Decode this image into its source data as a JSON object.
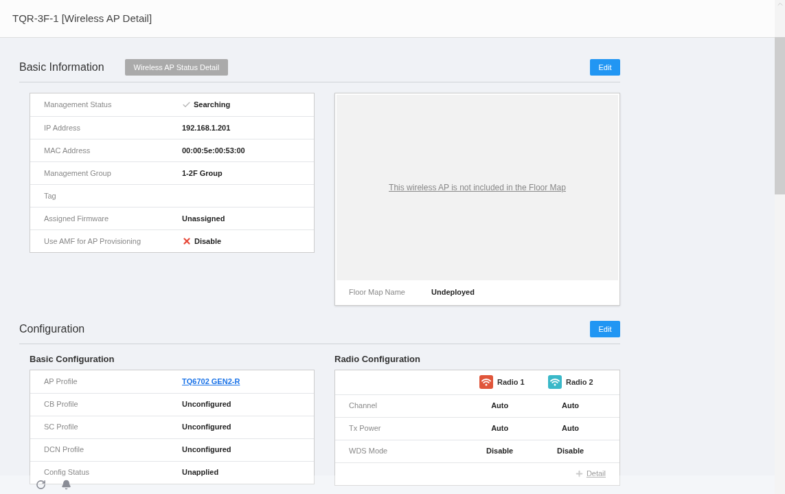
{
  "window": {
    "title": "TQR-3F-1 [Wireless AP Detail]"
  },
  "basic_information": {
    "title": "Basic Information",
    "status_button": "Wireless AP Status Detail",
    "edit_button": "Edit",
    "rows": [
      {
        "label": "Management Status",
        "value": "Searching",
        "kind": "check"
      },
      {
        "label": "IP Address",
        "value": "192.168.1.201",
        "kind": "text"
      },
      {
        "label": "MAC Address",
        "value": "00:00:5e:00:53:00",
        "kind": "text"
      },
      {
        "label": "Management Group",
        "value": "1-2F Group",
        "kind": "text"
      },
      {
        "label": "Tag",
        "value": "",
        "kind": "text"
      },
      {
        "label": "Assigned Firmware",
        "value": "Unassigned",
        "kind": "text"
      },
      {
        "label": "Use AMF for AP Provisioning",
        "value": "Disable",
        "kind": "cross"
      }
    ],
    "floor_map": {
      "message": "This wireless AP is not included in the Floor Map",
      "name_label": "Floor Map Name",
      "name_value": "Undeployed"
    }
  },
  "configuration": {
    "title": "Configuration",
    "edit_button": "Edit",
    "basic": {
      "title": "Basic Configuration",
      "rows": [
        {
          "label": "AP Profile",
          "value": "TQ6702 GEN2-R",
          "kind": "link"
        },
        {
          "label": "CB Profile",
          "value": "Unconfigured",
          "kind": "text"
        },
        {
          "label": "SC Profile",
          "value": "Unconfigured",
          "kind": "text"
        },
        {
          "label": "DCN Profile",
          "value": "Unconfigured",
          "kind": "text"
        },
        {
          "label": "Config Status",
          "value": "Unapplied",
          "kind": "text"
        }
      ]
    },
    "radio": {
      "title": "Radio Configuration",
      "radios": [
        {
          "name": "Radio 1",
          "color": "#e0553a"
        },
        {
          "name": "Radio 2",
          "color": "#3ab8c8"
        }
      ],
      "rows": [
        {
          "label": "Channel",
          "values": [
            "Auto",
            "Auto"
          ]
        },
        {
          "label": "Tx Power",
          "values": [
            "Auto",
            "Auto"
          ]
        },
        {
          "label": "WDS Mode",
          "values": [
            "Disable",
            "Disable"
          ]
        }
      ],
      "detail_link": "Detail"
    }
  }
}
